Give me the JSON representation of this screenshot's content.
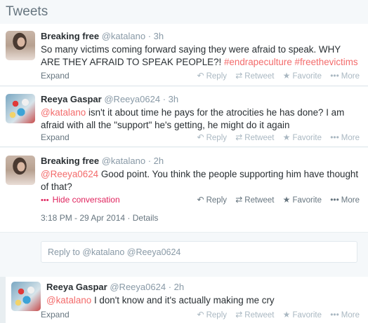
{
  "header": {
    "title": "Tweets"
  },
  "tweets": [
    {
      "name": "Breaking free",
      "handle": "@katalano",
      "time": "· 3h",
      "text_plain": "So many victims coming forward saying they were afraid to speak. WHY ARE THEY AFRAID TO SPEAK PEOPLE?! ",
      "hashtags": [
        "#endrapeculture",
        "#freethevictims"
      ],
      "expand": "Expand"
    },
    {
      "name": "Reeya Gaspar",
      "handle": "@Reeya0624",
      "time": "· 3h",
      "mention": "@katalano",
      "text_plain": " isn't it about time he pays for  the atrocities he has done? I am afraid with all the \"support\" he's getting, he might do it again",
      "expand": "Expand"
    },
    {
      "name": "Breaking free",
      "handle": "@katalano",
      "time": "· 2h",
      "mention": "@Reeya0624",
      "text_plain": " Good point. You think the people supporting him have thought of that?",
      "hide_conversation": "Hide conversation",
      "meta": "3:18 PM - 29 Apr 2014 · Details"
    },
    {
      "name": "Reeya Gaspar",
      "handle": "@Reeya0624",
      "time": "· 2h",
      "mention": "@katalano",
      "text_plain": " I don't know and it's actually making me cry",
      "expand": "Expand"
    }
  ],
  "actions": {
    "reply": "Reply",
    "retweet": "Retweet",
    "favorite": "Favorite",
    "more": "More"
  },
  "icons": {
    "reply": "reply-arrow-icon",
    "retweet": "retweet-icon",
    "favorite": "star-icon",
    "more": "ellipsis-icon",
    "hide": "ellipsis-icon"
  },
  "reply_box": {
    "placeholder": "Reply to @katalano @Reeya0624"
  },
  "colors": {
    "link": "#e0245e",
    "muted": "#8899a6",
    "background": "#f5f8fa"
  }
}
